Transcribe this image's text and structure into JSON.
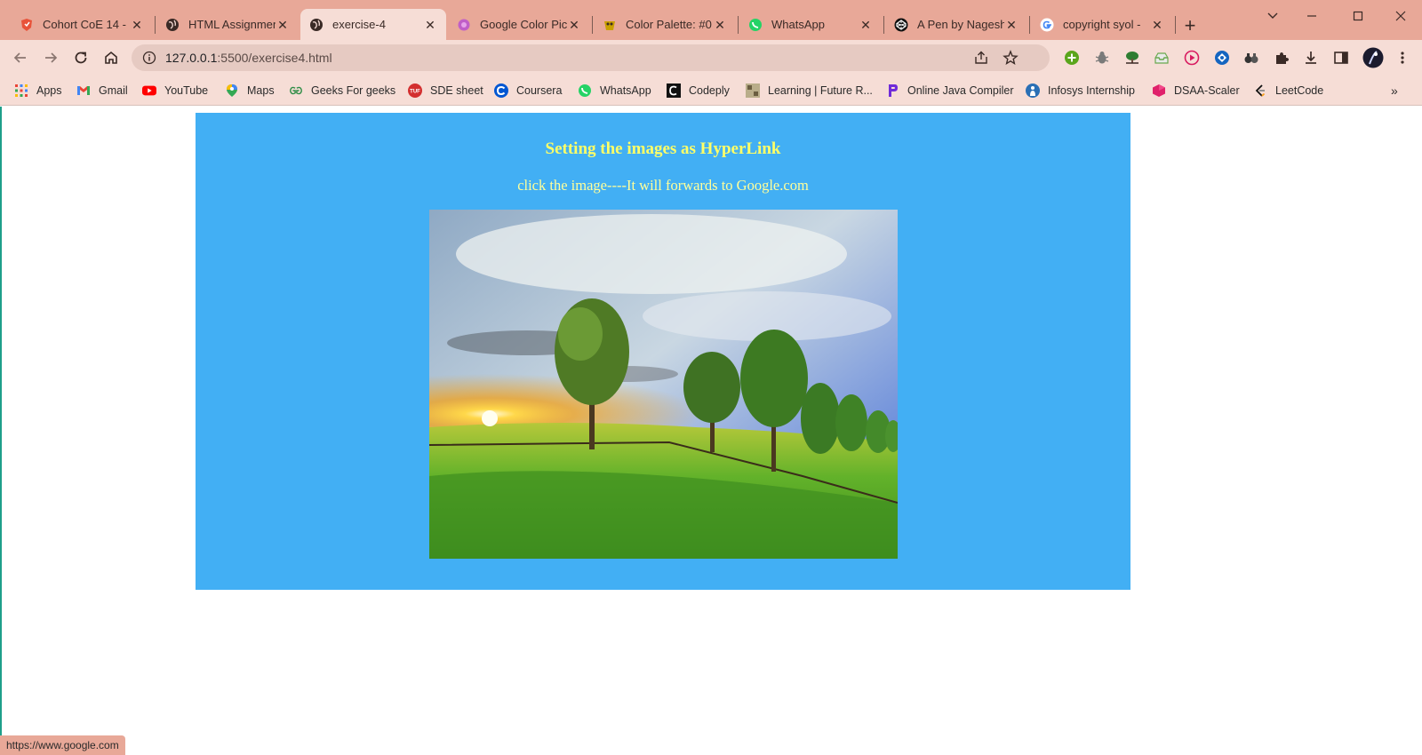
{
  "tabs": [
    {
      "title": "Cohort CoE 14 - ",
      "icon": "shield-icon",
      "icon_color": "#e8533a"
    },
    {
      "title": "HTML Assignmen",
      "icon": "globe-icon",
      "icon_color": "#3a2a26"
    },
    {
      "title": "exercise-4",
      "icon": "globe-icon",
      "icon_color": "#3a2a26",
      "active": true
    },
    {
      "title": "Google Color Pic",
      "icon": "color-dot-icon",
      "icon_color": "#c05ec8"
    },
    {
      "title": "Color Palette: #0",
      "icon": "palette-icon",
      "icon_color": "#c9a000"
    },
    {
      "title": "WhatsApp",
      "icon": "whatsapp-icon",
      "icon_color": "#25d366"
    },
    {
      "title": "A Pen by Nagesh",
      "icon": "codepen-icon",
      "icon_color": "#111111"
    },
    {
      "title": "copyright syol - ",
      "icon": "google-icon",
      "icon_color": "#4285f4"
    }
  ],
  "address_bar": {
    "host": "127.0.0.1",
    "path": ":5500/exercise4.html"
  },
  "bookmarks": [
    {
      "label": "Apps",
      "icon": "apps-grid-icon",
      "icon_color": "#4285f4"
    },
    {
      "label": "Gmail",
      "icon": "gmail-icon",
      "icon_color": "#ea4335"
    },
    {
      "label": "YouTube",
      "icon": "youtube-icon",
      "icon_color": "#ff0000"
    },
    {
      "label": "Maps",
      "icon": "maps-pin-icon",
      "icon_color": "#34a853"
    },
    {
      "label": "Geeks For geeks",
      "icon": "gfg-icon",
      "icon_color": "#2f8d46"
    },
    {
      "label": "SDE sheet",
      "icon": "tuf-icon",
      "icon_color": "#d32f2f"
    },
    {
      "label": "Coursera",
      "icon": "coursera-icon",
      "icon_color": "#0056d2"
    },
    {
      "label": "WhatsApp",
      "icon": "whatsapp-icon",
      "icon_color": "#25d366"
    },
    {
      "label": "Codeply",
      "icon": "codeply-icon",
      "icon_color": "#111111"
    },
    {
      "label": "Learning | Future R...",
      "icon": "future-icon",
      "icon_color": "#8a7a60"
    },
    {
      "label": "Online Java Compiler",
      "icon": "programiz-icon",
      "icon_color": "#6f2bd9"
    },
    {
      "label": "Infosys Internship",
      "icon": "infosys-icon",
      "icon_color": "#2a6fb5"
    },
    {
      "label": "DSAA-Scaler",
      "icon": "scaler-icon",
      "icon_color": "#e0216b"
    },
    {
      "label": "LeetCode",
      "icon": "leetcode-icon",
      "icon_color": "#f89f1b"
    }
  ],
  "page": {
    "heading": "Setting the images as HyperLink",
    "subline": "click the image----It will forwards to Google.com",
    "panel_color": "#42aff4",
    "text_color": "#ffff66"
  },
  "status_url": "https://www.google.com"
}
